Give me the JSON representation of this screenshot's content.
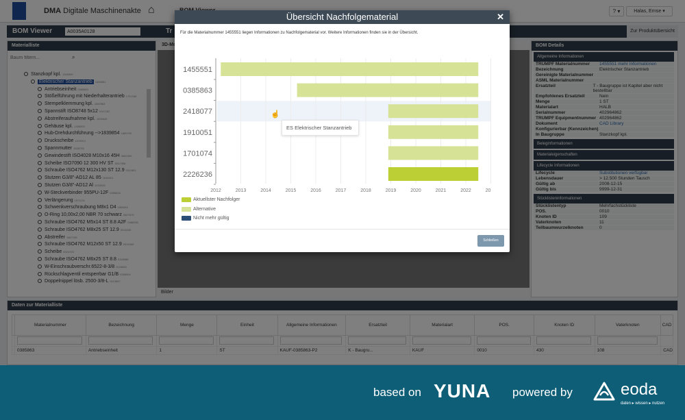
{
  "header": {
    "logo_text": "DMA",
    "app_bold": "DMA",
    "app_title": "Digitale Maschinenakte",
    "breadcrumb": "BOM Viewer",
    "help": "? ▾",
    "user": "Halas, Ernse ▾"
  },
  "bom_bar": {
    "title": "BOM Viewer",
    "input_value": "A0035A0128",
    "tab_partial": "Tr",
    "product_overview": "Zur Produktübersicht"
  },
  "left_panel": {
    "title": "Materialliste",
    "filter_placeholder": "Baum filtern...",
    "tree": [
      {
        "label": "Stanzkopf kpl.",
        "num": "1348599",
        "level": 0
      },
      {
        "label": "Elektrischer Stanzantrieb",
        "num": "1455551",
        "level": 1,
        "selected": true
      },
      {
        "label": "Antriebseinheit",
        "num": "0385863",
        "level": 2
      },
      {
        "label": "Stößelführung mit Niederhalterantrieb",
        "num": "1721268",
        "level": 2
      },
      {
        "label": "Stempelklemmung kpl.",
        "num": "1550983",
        "level": 2
      },
      {
        "label": "Spannstift ISO8748 5x12",
        "num": "0147182",
        "level": 2
      },
      {
        "label": "Abstreiferaufnahme kpl.",
        "num": "1539549",
        "level": 2
      },
      {
        "label": "Gehäuse kpl.",
        "num": "1455553",
        "level": 2
      },
      {
        "label": "Hub-Drehdurchführung -->1839854",
        "num": "1889790",
        "level": 2
      },
      {
        "label": "Druckscheibe",
        "num": "1570914",
        "level": 2
      },
      {
        "label": "Spannmutter",
        "num": "1526793",
        "level": 2
      },
      {
        "label": "Gewindestift ISO4028 M10x16 45H",
        "num": "0600409",
        "level": 2
      },
      {
        "label": "Scheibe ISO7090 12 300 HV ST",
        "num": "0017396",
        "level": 2
      },
      {
        "label": "Schraube ISO4762 M12x130 ST 12.9",
        "num": "0111861",
        "level": 2
      },
      {
        "label": "Stutzen G3/8\"-AD12 AL 85",
        "num": "1630421",
        "level": 2
      },
      {
        "label": "Stutzen G3/8\"-AD12 Al",
        "num": "1233035",
        "level": 2
      },
      {
        "label": "W-Steckverbinder 955PU-12F",
        "num": "0355834",
        "level": 2
      },
      {
        "label": "Verlängerung",
        "num": "1571131",
        "level": 2
      },
      {
        "label": "Schwenkverschraubung M8x1 D4",
        "num": "0356001",
        "level": 2
      },
      {
        "label": "O-Ring 10,00x2,00 NBR 70 schwarz",
        "num": "0607670",
        "level": 2
      },
      {
        "label": "Schraube ISO4762 M5x14 ST 8.8 A2F",
        "num": "0088280",
        "level": 2
      },
      {
        "label": "Schraube ISO4762 M8x25 ST 12.9",
        "num": "0016035",
        "level": 2
      },
      {
        "label": "Abstreifer",
        "num": "1667155",
        "level": 2
      },
      {
        "label": "Schraube ISO4762 M12x50 ST 12.9",
        "num": "0015369",
        "level": 2
      },
      {
        "label": "Scheibe",
        "num": "0024753",
        "level": 2
      },
      {
        "label": "Schraube ISO4762 M6x25 ST 8.8",
        "num": "0146986",
        "level": 2
      },
      {
        "label": "W-Einschraubverschr.6522-8-3/8",
        "num": "0126663",
        "level": 2
      },
      {
        "label": "Rückschlagventil entsperrbar G1/B",
        "num": "0355994",
        "level": 2
      },
      {
        "label": "Doppelnippel lösb. 2500-3/8-L",
        "num": "0113867",
        "level": 2
      }
    ]
  },
  "middle_panel": {
    "title": "3D-Mo",
    "footer": "Bilder"
  },
  "right_panel": {
    "title": "BOM Details",
    "sections": [
      {
        "title": "Allgemeine Informationen",
        "rows": [
          [
            "TRUMPF Materialnummer",
            "1455551 mehr Informationen"
          ],
          [
            "Bezeichnung",
            "Elektrischer Stanzantrieb"
          ],
          [
            "Gereinigte Materialnummer",
            ""
          ],
          [
            "ASML Materialnummer",
            ""
          ],
          [
            "Ersatzteil",
            "T - Baugruppe ist Kapitel aber nicht bestellbar"
          ],
          [
            "Empfohlenes Ersatzteil",
            "Nein"
          ],
          [
            "Menge",
            "1 ST"
          ],
          [
            "Materialart",
            "HALB"
          ],
          [
            "Serialnummer",
            "402964862"
          ],
          [
            "TRUMPF Equipmentnummer",
            "402964862"
          ],
          [
            "Dokument",
            "CAD Library"
          ],
          [
            "Konfigurierbar (Kennzeichen)",
            ""
          ],
          [
            "In Baugruppe",
            "Stanzkopf kpl."
          ]
        ]
      },
      {
        "title": "Beleginformationen",
        "rows": []
      },
      {
        "title": "Materialeigenschaften",
        "rows": []
      },
      {
        "title": "Lifecycle Informationen",
        "rows": [
          [
            "Lifecycle",
            "Substitutionen verfügbar"
          ],
          [
            "Lebensdauer",
            "> 12.500 Stunden Tausch"
          ],
          [
            "Gültig ab",
            "2008-12-15"
          ],
          [
            "Gültig bis",
            "9999-12-31"
          ]
        ]
      },
      {
        "title": "Stücklisteninformationen",
        "rows": [
          [
            "Stücklistentyp",
            "Mehrfachstückliste"
          ],
          [
            "POS.",
            "0010"
          ],
          [
            "Knoten ID",
            "109"
          ],
          [
            "Vaterknoten",
            "11"
          ],
          [
            "Teilbaumwurzelknoten",
            "0"
          ]
        ]
      }
    ]
  },
  "bottom_panel": {
    "title": "Daten zur Materialliste",
    "columns": [
      "",
      "Materialnummer",
      "Bezeichnung",
      "Menge",
      "Einheit",
      "Allgemeine Informationen",
      "Ersatzteil",
      "Materialart",
      "POS.",
      "Knoten ID",
      "Vaterknoten",
      "CAD"
    ],
    "rows": [
      [
        "",
        "0385863",
        "Antriebseinheit",
        "1",
        "ST",
        "KAUF-0385863-P2",
        "K - Baugru...",
        "KAUF",
        "0010",
        "430",
        "108",
        "CAD"
      ]
    ]
  },
  "modal": {
    "title": "Übersicht Nachfolgematerial",
    "intro": "Für die Materialnummer 1455551 liegen Informationen zu Nachfolgematerial vor. Weitere Informationen finden sie in der Übersicht.",
    "tooltip": "ES Elektrischer Stanzantrieb",
    "close_button": "Schließen"
  },
  "chart_data": {
    "type": "bar",
    "orientation": "horizontal-timeline",
    "categories": [
      "1455551",
      "0385863",
      "2418077",
      "1910051",
      "1701074",
      "2226236"
    ],
    "start": [
      2012.2,
      2015.25,
      2018.9,
      2018.9,
      2018.9,
      2018.9
    ],
    "end": [
      2022.5,
      2022.5,
      2022.5,
      2022.5,
      2022.5,
      2022.5
    ],
    "kind": [
      "Alternative",
      "Alternative",
      "Alternative",
      "Alternative",
      "Alternative",
      "Aktuellster Nachfolger"
    ],
    "xlim": [
      2012,
      2023
    ],
    "xticks": [
      "2012",
      "2013",
      "2014",
      "2015",
      "2016",
      "2017",
      "2018",
      "2019",
      "2020",
      "2021",
      "2022",
      "20"
    ],
    "grid": true,
    "legend_placement": "bottom-left",
    "highlighted": "2418077",
    "legend": [
      {
        "name": "Aktuellster Nachfolger",
        "color": "#bccf35"
      },
      {
        "name": "Alternative",
        "color": "#d6e397"
      },
      {
        "name": "Nicht mehr gültig",
        "color": "#2c4f78"
      }
    ]
  },
  "banner": {
    "based_on": "based on",
    "yuna": "YUNA",
    "powered_by": "powered by",
    "eoda": "eoda",
    "eoda_sub": "daten ▸ wissen ▸ nutzen"
  }
}
